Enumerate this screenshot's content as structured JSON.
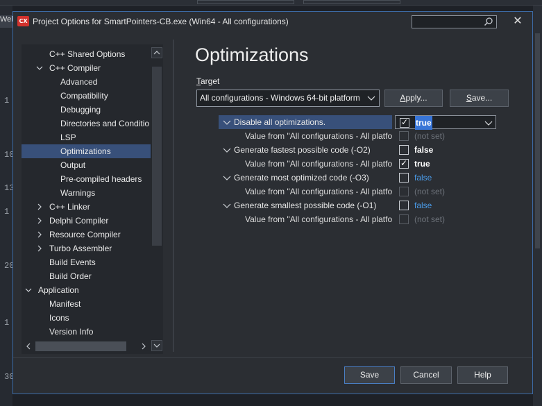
{
  "ide": {
    "tab_label": "Welc",
    "line_numbers": [
      "1",
      "10",
      "13",
      "1",
      "20",
      "1",
      "30"
    ]
  },
  "dialog": {
    "icon_text": "CX",
    "title": "Project Options for SmartPointers-CB.exe  (Win64 - All configurations)",
    "close_glyph": "✕",
    "search_value": ""
  },
  "tree": {
    "items": [
      {
        "label": "C++ Shared Options"
      },
      {
        "label": "C++ Compiler",
        "chev": "v"
      },
      {
        "label": "Advanced"
      },
      {
        "label": "Compatibility"
      },
      {
        "label": "Debugging"
      },
      {
        "label": "Directories and Conditio"
      },
      {
        "label": "LSP"
      },
      {
        "label": "Optimizations"
      },
      {
        "label": "Output"
      },
      {
        "label": "Pre-compiled headers"
      },
      {
        "label": "Warnings"
      },
      {
        "label": "C++ Linker",
        "chev": ">"
      },
      {
        "label": "Delphi Compiler",
        "chev": ">"
      },
      {
        "label": "Resource Compiler",
        "chev": ">"
      },
      {
        "label": "Turbo Assembler",
        "chev": ">"
      },
      {
        "label": "Build Events"
      },
      {
        "label": "Build Order"
      },
      {
        "label": "Application",
        "chev": "v"
      },
      {
        "label": "Manifest"
      },
      {
        "label": "Icons"
      },
      {
        "label": "Version Info"
      }
    ],
    "selected": "Optimizations",
    "scroll_up": "▲",
    "scroll_down": "▼",
    "scroll_left": "<",
    "scroll_right": ">"
  },
  "main": {
    "title": "Optimizations",
    "target_label_first": "T",
    "target_label_rest": "arget",
    "target_value": "All configurations - Windows 64-bit platform",
    "apply_first": "A",
    "apply_rest": "pply...",
    "save_first": "S",
    "save_rest": "ave..."
  },
  "grid": {
    "rows": [
      {
        "name": "Disable all optimizations.",
        "value": "true",
        "checked": true
      },
      {
        "name": "Value from \"All configurations - All platforms\"",
        "value": "(not set)"
      },
      {
        "name": "Generate fastest possible code (-O2)",
        "value": "false"
      },
      {
        "name": "Value from \"All configurations - All platforms\"",
        "value": "true",
        "checked": true
      },
      {
        "name": "Generate most optimized code (-O3)",
        "value": "false"
      },
      {
        "name": "Value from \"All configurations - All platforms\"",
        "value": "(not set)"
      },
      {
        "name": "Generate smallest possible code (-O1)",
        "value": "false"
      },
      {
        "name": "Value from \"All configurations - All platforms\"",
        "value": "(not set)"
      }
    ]
  },
  "footer": {
    "save": "Save",
    "cancel": "Cancel",
    "help": "Help"
  },
  "colors": {
    "accent_blue": "#4a9be8",
    "selection": "#38507a",
    "dialog_bg": "#2b2e33",
    "icon_red": "#d2322d"
  }
}
